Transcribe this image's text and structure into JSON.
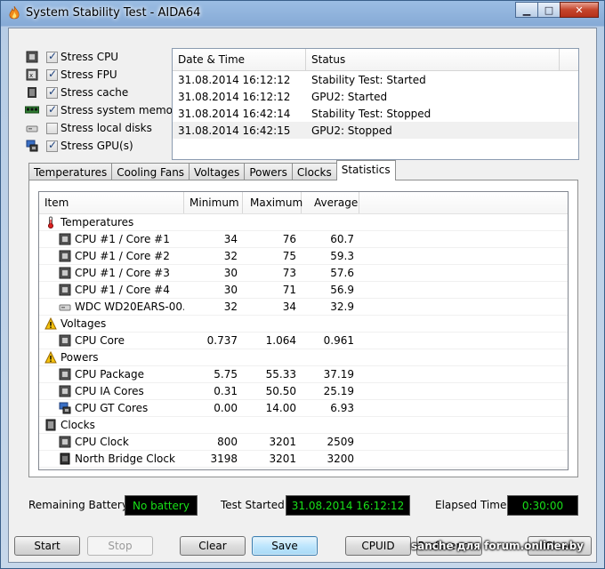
{
  "window": {
    "title": "System Stability Test - AIDA64",
    "minimize": "▁",
    "maximize": "□",
    "close": "✕"
  },
  "options": [
    {
      "label": "Stress CPU",
      "checked": true,
      "icon": "cpu-chip-icon"
    },
    {
      "label": "Stress FPU",
      "checked": true,
      "icon": "fpu-chip-icon"
    },
    {
      "label": "Stress cache",
      "checked": true,
      "icon": "cache-chip-icon"
    },
    {
      "label": "Stress system memory",
      "checked": true,
      "icon": "memory-module-icon"
    },
    {
      "label": "Stress local disks",
      "checked": false,
      "icon": "hard-disk-icon"
    },
    {
      "label": "Stress GPU(s)",
      "checked": true,
      "icon": "gpu-monitor-icon"
    }
  ],
  "log": {
    "columns": [
      "Date & Time",
      "Status"
    ],
    "rows": [
      {
        "datetime": "31.08.2014 16:12:12",
        "status": "Stability Test: Started"
      },
      {
        "datetime": "31.08.2014 16:12:12",
        "status": "GPU2: Started"
      },
      {
        "datetime": "31.08.2014 16:42:14",
        "status": "Stability Test: Stopped"
      },
      {
        "datetime": "31.08.2014 16:42:15",
        "status": "GPU2: Stopped"
      }
    ]
  },
  "tabs": [
    "Temperatures",
    "Cooling Fans",
    "Voltages",
    "Powers",
    "Clocks",
    "Statistics"
  ],
  "active_tab": "Statistics",
  "stats": {
    "columns": [
      "Item",
      "Minimum",
      "Maximum",
      "Average"
    ],
    "rows": [
      {
        "group": true,
        "label": "Temperatures",
        "icon": "thermometer-icon"
      },
      {
        "label": "CPU #1 / Core #1",
        "min": "34",
        "max": "76",
        "avg": "60.7",
        "icon": "cpu-chip-icon"
      },
      {
        "label": "CPU #1 / Core #2",
        "min": "32",
        "max": "75",
        "avg": "59.3",
        "icon": "cpu-chip-icon"
      },
      {
        "label": "CPU #1 / Core #3",
        "min": "30",
        "max": "73",
        "avg": "57.6",
        "icon": "cpu-chip-icon"
      },
      {
        "label": "CPU #1 / Core #4",
        "min": "30",
        "max": "71",
        "avg": "56.9",
        "icon": "cpu-chip-icon"
      },
      {
        "label": "WDC WD20EARS-00...",
        "min": "32",
        "max": "34",
        "avg": "32.9",
        "icon": "hard-disk-icon"
      },
      {
        "group": true,
        "label": "Voltages",
        "icon": "warning-icon"
      },
      {
        "label": "CPU Core",
        "min": "0.737",
        "max": "1.064",
        "avg": "0.961",
        "icon": "cpu-chip-icon"
      },
      {
        "group": true,
        "label": "Powers",
        "icon": "warning-icon"
      },
      {
        "label": "CPU Package",
        "min": "5.75",
        "max": "55.33",
        "avg": "37.19",
        "icon": "cpu-chip-icon"
      },
      {
        "label": "CPU IA Cores",
        "min": "0.31",
        "max": "50.50",
        "avg": "25.19",
        "icon": "cpu-chip-icon"
      },
      {
        "label": "CPU GT Cores",
        "min": "0.00",
        "max": "14.00",
        "avg": "6.93",
        "icon": "gpu-monitor-icon"
      },
      {
        "group": true,
        "label": "Clocks",
        "icon": "clock-chip-icon"
      },
      {
        "label": "CPU Clock",
        "min": "800",
        "max": "3201",
        "avg": "2509",
        "icon": "cpu-chip-icon"
      },
      {
        "label": "North Bridge Clock",
        "min": "3198",
        "max": "3201",
        "avg": "3200",
        "icon": "chipset-icon"
      }
    ]
  },
  "status": {
    "battery_label": "Remaining Battery:",
    "battery_value": "No battery",
    "started_label": "Test Started:",
    "started_value": "31.08.2014 16:12:12",
    "elapsed_label": "Elapsed Time:",
    "elapsed_value": "0:30:00",
    "value_color": "#18e018"
  },
  "buttons": {
    "start": "Start",
    "stop": "Stop",
    "clear": "Clear",
    "save": "Save",
    "cpuid": "CPUID",
    "preferences": "Preferences",
    "close": "Close"
  },
  "watermark": "sanche для forum.onliner.by"
}
